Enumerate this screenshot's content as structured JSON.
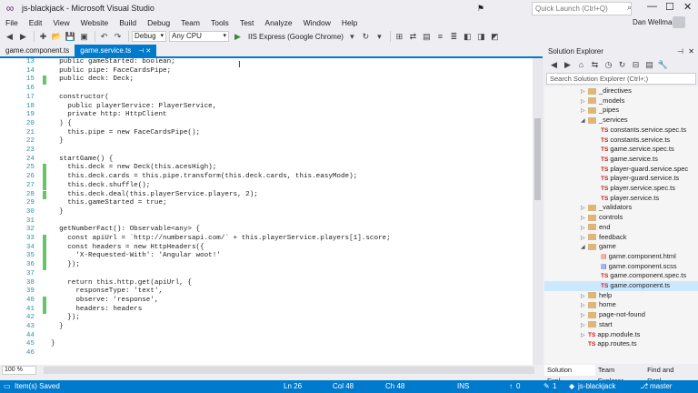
{
  "window": {
    "title": "js-blackjack - Microsoft Visual Studio"
  },
  "quick_launch": {
    "placeholder": "Quick Launch (Ctrl+Q)"
  },
  "menu": [
    "File",
    "Edit",
    "View",
    "Website",
    "Build",
    "Debug",
    "Team",
    "Tools",
    "Test",
    "Analyze",
    "Window",
    "Help"
  ],
  "user": {
    "name": "Dan Wellman"
  },
  "toolbar": {
    "config": "Debug",
    "platform": "Any CPU",
    "run_target": "IIS Express (Google Chrome)"
  },
  "tabs": [
    {
      "label": "game.component.ts",
      "active": false
    },
    {
      "label": "game.service.ts",
      "active": true
    }
  ],
  "code_lines": [
    {
      "n": "13",
      "text": "  public gameStarted: boolean;",
      "changed": false
    },
    {
      "n": "14",
      "text": "  public pipe: FaceCardsPipe;",
      "changed": false
    },
    {
      "n": "15",
      "text": "  public deck: Deck;",
      "changed": true
    },
    {
      "n": "16",
      "text": "",
      "changed": false
    },
    {
      "n": "17",
      "text": "  constructor(",
      "changed": false
    },
    {
      "n": "18",
      "text": "    public playerService: PlayerService,",
      "changed": false
    },
    {
      "n": "19",
      "text": "    private http: HttpClient",
      "changed": false
    },
    {
      "n": "20",
      "text": "  ) {",
      "changed": false
    },
    {
      "n": "21",
      "text": "    this.pipe = new FaceCardsPipe();",
      "changed": false
    },
    {
      "n": "22",
      "text": "  }",
      "changed": false
    },
    {
      "n": "23",
      "text": "",
      "changed": false
    },
    {
      "n": "24",
      "text": "  startGame() {",
      "changed": false
    },
    {
      "n": "25",
      "text": "    this.deck = new Deck(this.acesHigh);",
      "changed": true
    },
    {
      "n": "26",
      "text": "    this.deck.cards = this.pipe.transform(this.deck.cards, this.easyMode);",
      "changed": true
    },
    {
      "n": "27",
      "text": "    this.deck.shuffle();",
      "changed": true
    },
    {
      "n": "28",
      "text": "    this.deck.deal(this.playerService.players, 2);",
      "changed": true
    },
    {
      "n": "29",
      "text": "    this.gameStarted = true;",
      "changed": false
    },
    {
      "n": "30",
      "text": "  }",
      "changed": false
    },
    {
      "n": "31",
      "text": "",
      "changed": false
    },
    {
      "n": "32",
      "text": "  getNumberFact(): Observable<any> {",
      "changed": false
    },
    {
      "n": "33",
      "text": "    const apiUrl = `http://numbersapi.com/` + this.playerService.players[1].score;",
      "changed": true
    },
    {
      "n": "34",
      "text": "    const headers = new HttpHeaders({",
      "changed": true
    },
    {
      "n": "35",
      "text": "      'X-Requested-With': 'Angular woot!'",
      "changed": true
    },
    {
      "n": "36",
      "text": "    });",
      "changed": true
    },
    {
      "n": "37",
      "text": "",
      "changed": false
    },
    {
      "n": "38",
      "text": "    return this.http.get(apiUrl, {",
      "changed": false
    },
    {
      "n": "39",
      "text": "      responseType: 'text',",
      "changed": false
    },
    {
      "n": "40",
      "text": "      observe: 'response',",
      "changed": true
    },
    {
      "n": "41",
      "text": "      headers: headers",
      "changed": true
    },
    {
      "n": "42",
      "text": "    });",
      "changed": false
    },
    {
      "n": "43",
      "text": "  }",
      "changed": false
    },
    {
      "n": "44",
      "text": "",
      "changed": false
    },
    {
      "n": "45",
      "text": "}",
      "changed": false
    },
    {
      "n": "46",
      "text": "",
      "changed": false
    }
  ],
  "zoom": "100 %",
  "solution_explorer": {
    "title": "Solution Explorer",
    "search_placeholder": "Search Solution Explorer (Ctrl+;)",
    "nodes": [
      {
        "label": "_directives",
        "kind": "folder",
        "depth": 1,
        "arrow": "▷"
      },
      {
        "label": "_models",
        "kind": "folder",
        "depth": 1,
        "arrow": "▷"
      },
      {
        "label": "_pipes",
        "kind": "folder",
        "depth": 1,
        "arrow": "▷"
      },
      {
        "label": "_services",
        "kind": "folder",
        "depth": 1,
        "arrow": "◢"
      },
      {
        "label": "constants.service.spec.ts",
        "kind": "ts",
        "depth": 2,
        "arrow": ""
      },
      {
        "label": "constants.service.ts",
        "kind": "ts",
        "depth": 2,
        "arrow": ""
      },
      {
        "label": "game.service.spec.ts",
        "kind": "ts",
        "depth": 2,
        "arrow": ""
      },
      {
        "label": "game.service.ts",
        "kind": "ts",
        "depth": 2,
        "arrow": ""
      },
      {
        "label": "player-guard.service.spec",
        "kind": "ts",
        "depth": 2,
        "arrow": ""
      },
      {
        "label": "player-guard.service.ts",
        "kind": "ts",
        "depth": 2,
        "arrow": ""
      },
      {
        "label": "player.service.spec.ts",
        "kind": "ts",
        "depth": 2,
        "arrow": ""
      },
      {
        "label": "player.service.ts",
        "kind": "ts",
        "depth": 2,
        "arrow": ""
      },
      {
        "label": "_validators",
        "kind": "folder",
        "depth": 1,
        "arrow": "▷"
      },
      {
        "label": "controls",
        "kind": "folder",
        "depth": 1,
        "arrow": "▷"
      },
      {
        "label": "end",
        "kind": "folder",
        "depth": 1,
        "arrow": "▷"
      },
      {
        "label": "feedback",
        "kind": "folder",
        "depth": 1,
        "arrow": "▷"
      },
      {
        "label": "game",
        "kind": "folder",
        "depth": 1,
        "arrow": "◢"
      },
      {
        "label": "game.component.html",
        "kind": "html",
        "depth": 2,
        "arrow": ""
      },
      {
        "label": "game.component.scss",
        "kind": "css",
        "depth": 2,
        "arrow": ""
      },
      {
        "label": "game.component.spec.ts",
        "kind": "ts",
        "depth": 2,
        "arrow": ""
      },
      {
        "label": "game.component.ts",
        "kind": "ts",
        "depth": 2,
        "arrow": "",
        "selected": true
      },
      {
        "label": "help",
        "kind": "folder",
        "depth": 1,
        "arrow": "▷"
      },
      {
        "label": "home",
        "kind": "folder",
        "depth": 1,
        "arrow": "▷"
      },
      {
        "label": "page-not-found",
        "kind": "folder",
        "depth": 1,
        "arrow": "▷"
      },
      {
        "label": "start",
        "kind": "folder",
        "depth": 1,
        "arrow": "▷"
      },
      {
        "label": "app.module.ts",
        "kind": "ts",
        "depth": 1,
        "arrow": "▷"
      },
      {
        "label": "app.routes.ts",
        "kind": "ts",
        "depth": 1,
        "arrow": ""
      }
    ],
    "tabs": [
      "Solution Expl...",
      "Team Explorer",
      "Find and Repl..."
    ]
  },
  "status": {
    "message": "Item(s) Saved",
    "ln": "Ln 26",
    "col": "Col 48",
    "ch": "Ch 48",
    "mode": "INS",
    "errors": "0",
    "pending": "1",
    "repo": "js-blackjack",
    "branch": "master"
  },
  "colors": {
    "accent": "#007acc",
    "changed_line": "#68c36a",
    "selected_node": "#cce8ff"
  }
}
